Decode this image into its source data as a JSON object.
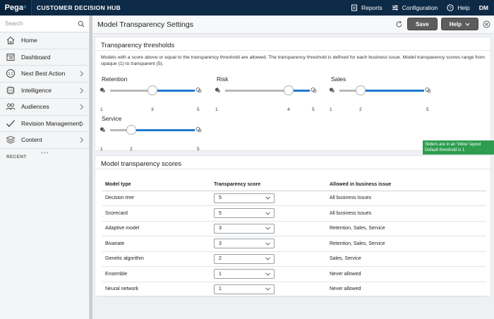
{
  "topbar": {
    "logo": "Pega",
    "logo_mark": "®",
    "app_name": "CUSTOMER DECISION HUB",
    "reports": "Reports",
    "configuration": "Configuration",
    "help": "Help",
    "user": "DM"
  },
  "sidebar": {
    "search_placeholder": "Search",
    "items": [
      {
        "label": "Home",
        "icon": "home-icon",
        "chevron": false
      },
      {
        "label": "Dashboard",
        "icon": "dashboard-icon",
        "chevron": false
      },
      {
        "label": "Next Best Action",
        "icon": "one-to-one-icon",
        "chevron": true
      },
      {
        "label": "Intelligence",
        "icon": "ai-chip-icon",
        "chevron": true
      },
      {
        "label": "Audiences",
        "icon": "people-icon",
        "chevron": true
      },
      {
        "label": "Revision Management",
        "icon": "checkmark-icon",
        "chevron": true
      },
      {
        "label": "Content",
        "icon": "stack-icon",
        "chevron": true
      }
    ],
    "recent_label": "RECENT"
  },
  "header": {
    "title": "Model Transparency Settings",
    "save_label": "Save",
    "help_label": "Help"
  },
  "thresholds": {
    "title": "Transparency thresholds",
    "description": "Models with a score above or equal to the transparency threshold are allowed. The transparency threshold is defined for each business issue. Model transparency scores range from opaque (1) to transparent (5).",
    "sliders": [
      {
        "label": "Retention",
        "min": 1,
        "max": 5,
        "value": 3
      },
      {
        "label": "Risk",
        "min": 1,
        "max": 5,
        "value": 4
      },
      {
        "label": "Sales",
        "min": 1,
        "max": 5,
        "value": 2
      },
      {
        "label": "Service",
        "min": 1,
        "max": 5,
        "value": 2
      }
    ],
    "tooltip_line1": "Sliders are in an 'Inline' layout",
    "tooltip_line2": "Default threshold is 1"
  },
  "scores": {
    "title": "Model transparency scores",
    "columns": [
      "Model type",
      "Transparency score",
      "Allowed in business issue"
    ],
    "rows": [
      {
        "model": "Decision tree",
        "score": "5",
        "allowed": "All business issues"
      },
      {
        "model": "Scorecard",
        "score": "5",
        "allowed": "All business issues"
      },
      {
        "model": "Adaptive model",
        "score": "3",
        "allowed": "Retention, Sales, Service"
      },
      {
        "model": "Bivariate",
        "score": "3",
        "allowed": "Retention, Sales, Service"
      },
      {
        "model": "Genetic algorithm",
        "score": "2",
        "allowed": "Sales, Service"
      },
      {
        "model": "Ensemble",
        "score": "1",
        "allowed": "Never allowed"
      },
      {
        "model": "Neural network",
        "score": "1",
        "allowed": "Never allowed"
      }
    ]
  },
  "colors": {
    "topbar": "#0d2a47",
    "accent": "#1f7ad1",
    "tooltip": "#2e9d4f",
    "button": "#5d5d5d"
  }
}
